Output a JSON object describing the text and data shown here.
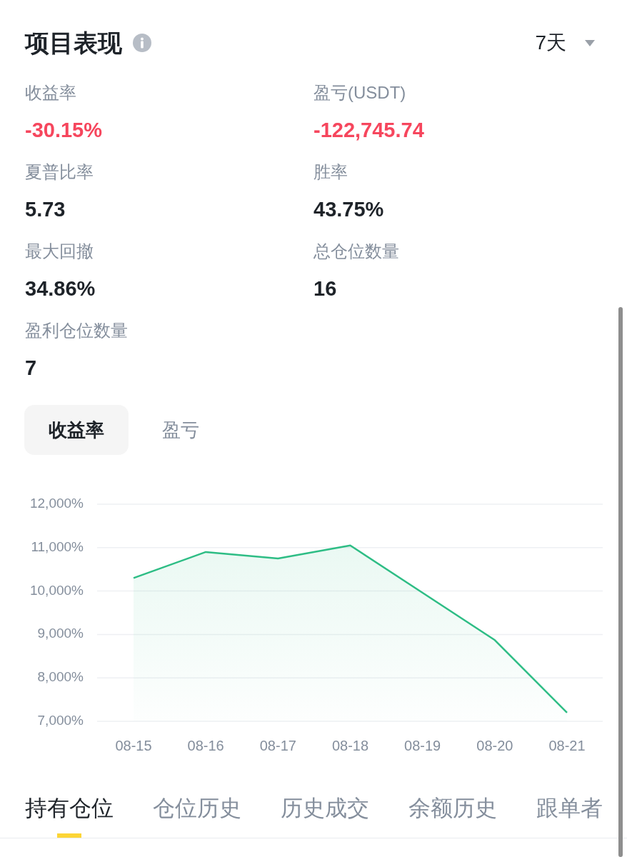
{
  "header": {
    "title": "项目表现",
    "period": "7天"
  },
  "stats": [
    {
      "label": "收益率",
      "value": "-30.15%",
      "negative": true
    },
    {
      "label": "盈亏(USDT)",
      "value": "-122,745.74",
      "negative": true
    },
    {
      "label": "夏普比率",
      "value": "5.73",
      "negative": false
    },
    {
      "label": "胜率",
      "value": "43.75%",
      "negative": false
    },
    {
      "label": "最大回撤",
      "value": "34.86%",
      "negative": false
    },
    {
      "label": "总仓位数量",
      "value": "16",
      "negative": false
    },
    {
      "label": "盈利仓位数量",
      "value": "7",
      "negative": false
    }
  ],
  "chart_tabs": [
    {
      "label": "收益率",
      "selected": true
    },
    {
      "label": "盈亏",
      "selected": false
    }
  ],
  "chart": {
    "chart_data": {
      "type": "area",
      "categories": [
        "08-15",
        "08-16",
        "08-17",
        "08-18",
        "08-19",
        "08-20",
        "08-21"
      ],
      "values": [
        10300,
        10900,
        10750,
        11050,
        9960,
        8870,
        7200
      ],
      "ylim": [
        7000,
        12000
      ],
      "yticks": [
        {
          "value": 7000,
          "label": "7,000%"
        },
        {
          "value": 8000,
          "label": "8,000%"
        },
        {
          "value": 9000,
          "label": "9,000%"
        },
        {
          "value": 10000,
          "label": "10,000%"
        },
        {
          "value": 11000,
          "label": "11,000%"
        },
        {
          "value": 12000,
          "label": "12,000%"
        }
      ],
      "grid": true
    }
  },
  "position_tabs": [
    {
      "label": "持有仓位",
      "selected": true
    },
    {
      "label": "仓位历史",
      "selected": false
    },
    {
      "label": "历史成交",
      "selected": false
    },
    {
      "label": "余额历史",
      "selected": false
    },
    {
      "label": "跟单者",
      "selected": false
    }
  ]
}
